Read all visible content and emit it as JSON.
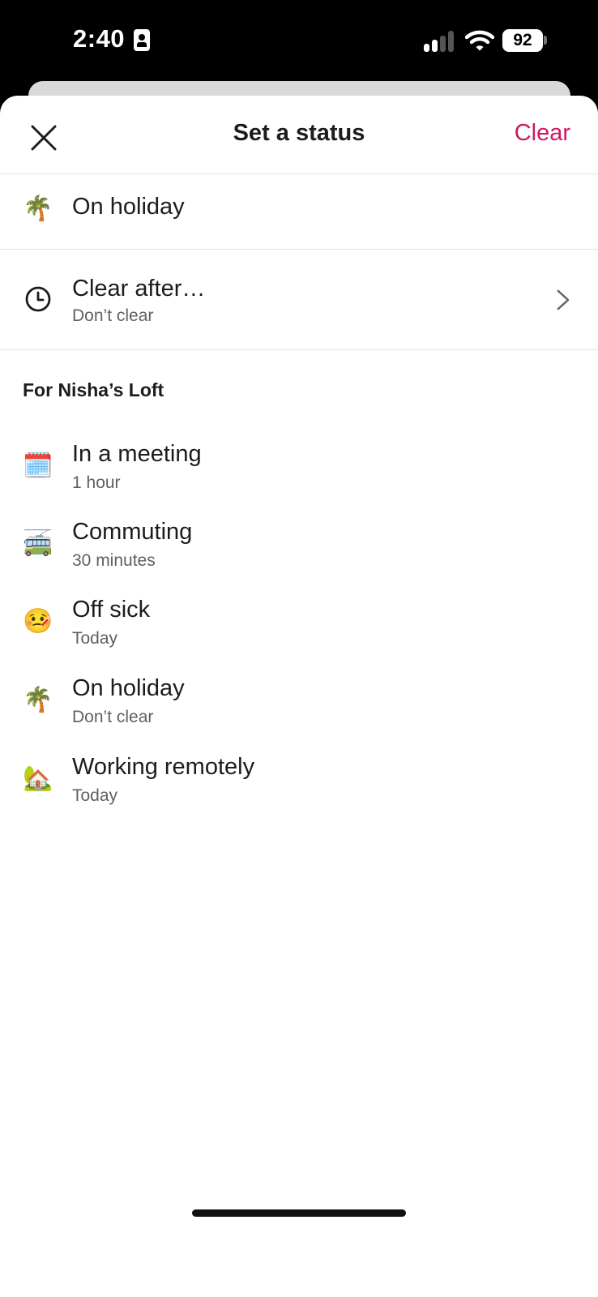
{
  "status_bar": {
    "time": "2:40",
    "battery": "92",
    "icons": [
      "id-card-icon",
      "cellular-signal-icon",
      "wifi-icon",
      "battery-icon"
    ]
  },
  "header": {
    "title": "Set a status",
    "clear_label": "Clear",
    "close_icon": "close-icon"
  },
  "current_status": {
    "emoji": "🌴",
    "text": "On holiday"
  },
  "clear_after": {
    "title": "Clear after…",
    "value": "Don’t clear",
    "icon": "clock-icon"
  },
  "presets": {
    "section_title": "For Nisha’s Loft",
    "items": [
      {
        "emoji": "🗓️",
        "title": "In a meeting",
        "duration": "1 hour"
      },
      {
        "emoji": "🚎",
        "title": "Commuting",
        "duration": "30 minutes"
      },
      {
        "emoji": "🤒",
        "title": "Off sick",
        "duration": "Today"
      },
      {
        "emoji": "🌴",
        "title": "On holiday",
        "duration": "Don’t clear"
      },
      {
        "emoji": "🏡",
        "title": "Working remotely",
        "duration": "Today"
      }
    ]
  },
  "colors": {
    "accent": "#d1165f",
    "text": "#1d1c1d",
    "subtext": "#616061",
    "divider": "#e3e3e3"
  }
}
